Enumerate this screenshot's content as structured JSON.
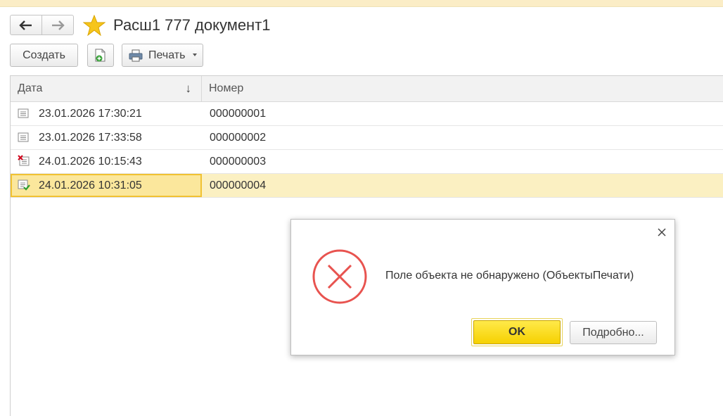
{
  "window": {
    "title": "Расш1 777 документ1"
  },
  "toolbar": {
    "create_label": "Создать",
    "print_label": "Печать"
  },
  "table": {
    "columns": [
      "Дата",
      "Номер"
    ],
    "sort_indicator": "↓",
    "rows": [
      {
        "date": "23.01.2026 17:30:21",
        "number": "000000001",
        "status_icon": "document-icon"
      },
      {
        "date": "23.01.2026 17:33:58",
        "number": "000000002",
        "status_icon": "document-icon"
      },
      {
        "date": "24.01.2026 10:15:43",
        "number": "000000003",
        "status_icon": "document-deleted-icon"
      },
      {
        "date": "24.01.2026 10:31:05",
        "number": "000000004",
        "status_icon": "document-posted-icon",
        "selected": true
      }
    ]
  },
  "dialog": {
    "message": "Поле объекта не обнаружено (ОбъектыПечати)",
    "ok_label": "OK",
    "details_label": "Подробно..."
  },
  "colors": {
    "accent_yellow": "#f6d100",
    "selection": "#fbe79c",
    "error_red": "#e8534f"
  }
}
